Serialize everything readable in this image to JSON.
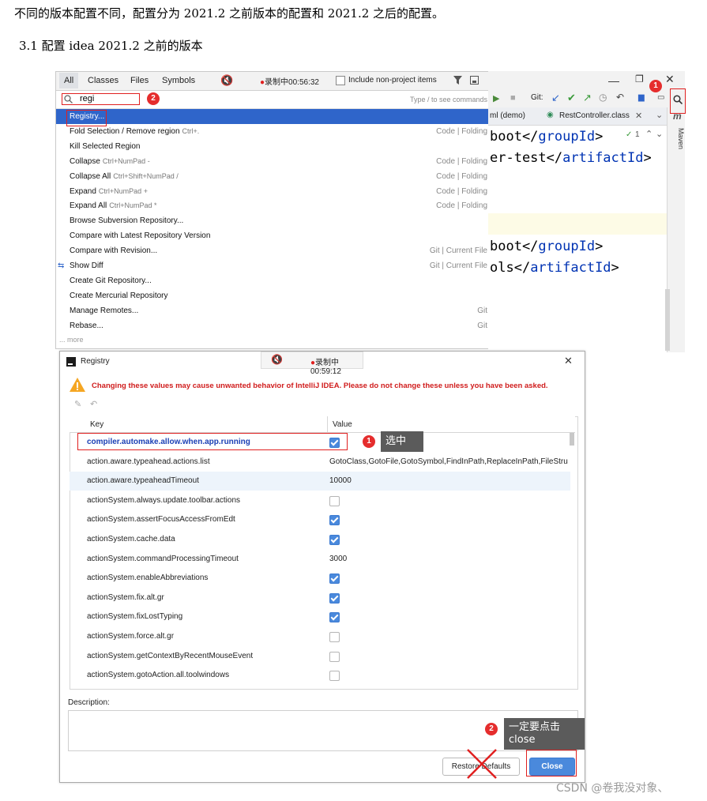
{
  "heading1": "不同的版本配置不同，配置分为 2021.2 之前版本的配置和 2021.2 之后的配置。",
  "heading2": "3.1 配置 idea 2021.2 之前的版本",
  "search_popup": {
    "tabs": [
      "All",
      "Classes",
      "Files",
      "Symbols"
    ],
    "recording_1": "录制中00:56:32",
    "include_non_project": "Include non-project items",
    "query": "regi",
    "hint": "Type / to see commands",
    "results": [
      {
        "label": "Registry...",
        "shortcut": "",
        "group": ""
      },
      {
        "label": "Fold Selection / Remove region",
        "shortcut": "Ctrl+.",
        "group": "Code | Folding"
      },
      {
        "label": "Kill Selected Region",
        "shortcut": "",
        "group": ""
      },
      {
        "label": "Collapse",
        "shortcut": "Ctrl+NumPad -",
        "group": "Code | Folding"
      },
      {
        "label": "Collapse All",
        "shortcut": "Ctrl+Shift+NumPad /",
        "group": "Code | Folding"
      },
      {
        "label": "Expand",
        "shortcut": "Ctrl+NumPad +",
        "group": "Code | Folding"
      },
      {
        "label": "Expand All",
        "shortcut": "Ctrl+NumPad *",
        "group": "Code | Folding"
      },
      {
        "label": "Browse Subversion Repository...",
        "shortcut": "",
        "group": ""
      },
      {
        "label": "Compare with Latest Repository Version",
        "shortcut": "",
        "group": ""
      },
      {
        "label": "Compare with Revision...",
        "shortcut": "",
        "group": "Git | Current File"
      },
      {
        "label": "Show Diff",
        "shortcut": "",
        "group": "Git | Current File"
      },
      {
        "label": "Create Git Repository...",
        "shortcut": "",
        "group": ""
      },
      {
        "label": "Create Mercurial Repository",
        "shortcut": "",
        "group": ""
      },
      {
        "label": "Manage Remotes...",
        "shortcut": "",
        "group": "Git"
      },
      {
        "label": "Rebase...",
        "shortcut": "",
        "group": "Git"
      }
    ],
    "more": "... more"
  },
  "ide": {
    "git_label": "Git:",
    "tab_demo": "ml (demo)",
    "tab_rest": "RestController.class",
    "maven": "Maven",
    "m_letter": "m",
    "warn_count": "1",
    "code_lines": [
      {
        "text": "boot</",
        "tag": "groupId",
        "end": ">"
      },
      {
        "text": "er-test</",
        "tag": "artifactId",
        "end": ">"
      },
      {
        "text": "boot</",
        "tag": "groupId",
        "end": ">"
      },
      {
        "text": "ols</",
        "tag": "artifactId",
        "end": ">"
      }
    ]
  },
  "registry": {
    "title": "Registry",
    "recording_2": "录制中00:59:12",
    "warning": "Changing these values may cause unwanted behavior of IntelliJ IDEA. Please do not change these unless you have been asked.",
    "col_key": "Key",
    "col_value": "Value",
    "rows": [
      {
        "key": "compiler.automake.allow.when.app.running",
        "type": "check",
        "checked": true,
        "highlight": true
      },
      {
        "key": "action.aware.typeahead.actions.list",
        "type": "text",
        "value": "GotoClass,GotoFile,GotoSymbol,FindInPath,ReplaceInPath,FileStru"
      },
      {
        "key": "action.aware.typeaheadTimeout",
        "type": "text",
        "value": "10000"
      },
      {
        "key": "actionSystem.always.update.toolbar.actions",
        "type": "check",
        "checked": false
      },
      {
        "key": "actionSystem.assertFocusAccessFromEdt",
        "type": "check",
        "checked": true
      },
      {
        "key": "actionSystem.cache.data",
        "type": "check",
        "checked": true
      },
      {
        "key": "actionSystem.commandProcessingTimeout",
        "type": "text",
        "value": "3000"
      },
      {
        "key": "actionSystem.enableAbbreviations",
        "type": "check",
        "checked": true
      },
      {
        "key": "actionSystem.fix.alt.gr",
        "type": "check",
        "checked": true
      },
      {
        "key": "actionSystem.fixLostTyping",
        "type": "check",
        "checked": true
      },
      {
        "key": "actionSystem.force.alt.gr",
        "type": "check",
        "checked": false
      },
      {
        "key": "actionSystem.getContextByRecentMouseEvent",
        "type": "check",
        "checked": false
      },
      {
        "key": "actionSystem.gotoAction.all.toolwindows",
        "type": "check",
        "checked": false
      }
    ],
    "description_label": "Description:",
    "restore_defaults": "Restore Defaults",
    "close": "Close"
  },
  "annotations": {
    "badge1": "1",
    "badge2": "2",
    "tip_select": "选中",
    "tip_close_1": "一定要点击",
    "tip_close_2": "close"
  },
  "watermark": "CSDN @卷我没对象、",
  "colors": {
    "selection": "#2f65ca",
    "warning_red": "#d01c1c",
    "annotation_red": "#e02020",
    "checkbox_blue": "#4a89dc",
    "close_button": "#4a89dc"
  }
}
